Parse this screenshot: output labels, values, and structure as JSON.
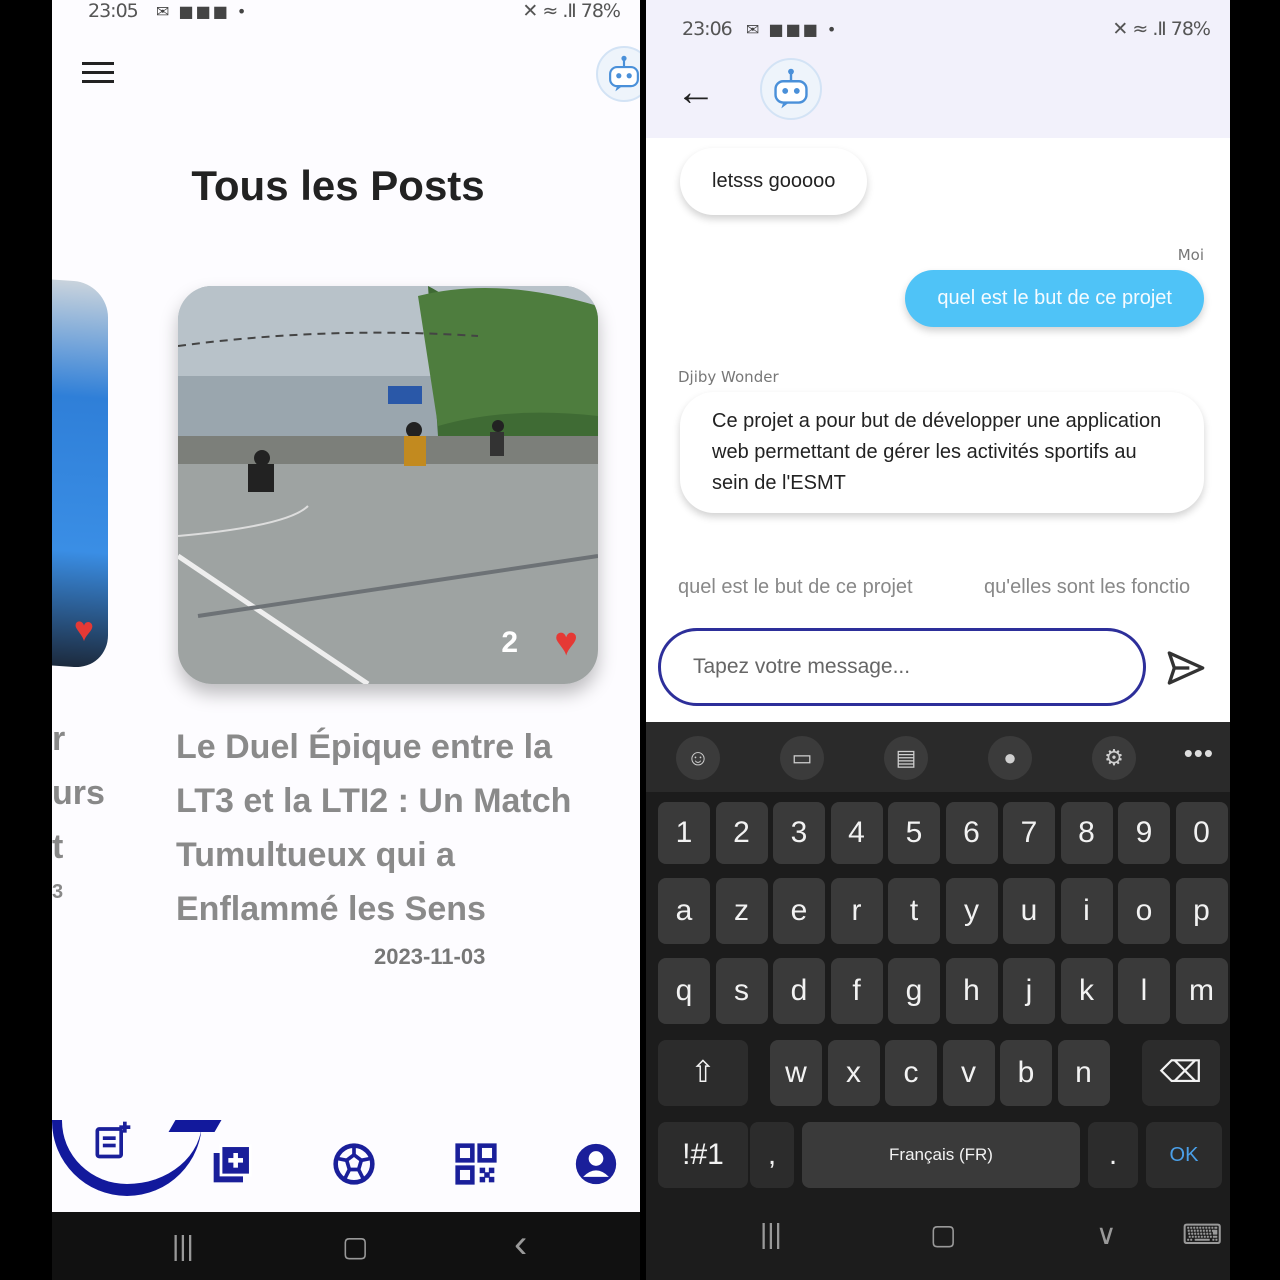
{
  "left_phone": {
    "status": {
      "time": "23:05",
      "icons": "✉ ■■■ •",
      "right": "✕ ≈ .Ⅱ 78%"
    },
    "page_title": "Tous les Posts",
    "side_card_text": [
      "r",
      "urs",
      "t",
      "3"
    ],
    "post": {
      "title": "Le Duel Épique entre la LT3 et la LTI2 : Un Match Tumultueux qui a Enflammé les Sens",
      "date": "2023-11-03",
      "likes": "2",
      "heart": "♥"
    },
    "bottom_nav": [
      "posts-icon",
      "add-post-icon",
      "football-icon",
      "qr-code-icon",
      "profile-icon"
    ],
    "sys_nav": {
      "recents": "|||",
      "home": "▢",
      "back": "‹"
    }
  },
  "right_phone": {
    "status": {
      "time": "23:06",
      "icons": "✉ ■■■ •",
      "right": "✕ ≈ .Ⅱ 78%"
    },
    "back": "←",
    "messages": [
      {
        "sender": "Djiby Wonder",
        "text": "letsss gooooo"
      },
      {
        "sender": "Moi",
        "text": "quel est le but de ce projet"
      },
      {
        "sender": "Djiby Wonder",
        "text": "Ce projet a pour but de développer une application web permettant de gérer les activités sportifs au sein de l'ESMT"
      }
    ],
    "suggestions": [
      "quel est le but de ce projet",
      "qu'elles sont les fonctio"
    ],
    "composer": {
      "placeholder": "Tapez votre message..."
    },
    "keyboard": {
      "numbers": [
        "1",
        "2",
        "3",
        "4",
        "5",
        "6",
        "7",
        "8",
        "9",
        "0"
      ],
      "row1": [
        "a",
        "z",
        "e",
        "r",
        "t",
        "y",
        "u",
        "i",
        "o",
        "p"
      ],
      "row2": [
        "q",
        "s",
        "d",
        "f",
        "g",
        "h",
        "j",
        "k",
        "l",
        "m"
      ],
      "row3": [
        "w",
        "x",
        "c",
        "v",
        "b",
        "n"
      ],
      "symbols": "!#1",
      "comma": ",",
      "space": "Français (FR)",
      "period": ".",
      "ok": "OK",
      "shift": "⇧",
      "backspace": "⌫",
      "more": "•••"
    },
    "sys_nav": {
      "recents": "|||",
      "home": "▢",
      "hide": "∨",
      "keyboard": "⌨"
    },
    "colors": {
      "my_bubble": "#4fc3f7",
      "accent": "#2d2f9a"
    }
  }
}
